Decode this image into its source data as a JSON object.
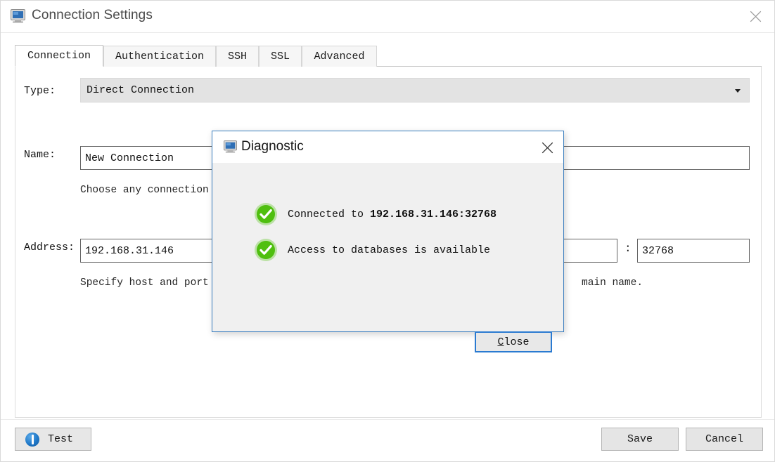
{
  "window": {
    "title": "Connection Settings",
    "icon": "monitor-icon",
    "close_icon": "close-icon"
  },
  "tabs": [
    {
      "label": "Connection",
      "active": true
    },
    {
      "label": "Authentication",
      "active": false
    },
    {
      "label": "SSH",
      "active": false
    },
    {
      "label": "SSL",
      "active": false
    },
    {
      "label": "Advanced",
      "active": false
    }
  ],
  "form": {
    "type_label": "Type:",
    "type_value": "Direct Connection",
    "name_label": "Name:",
    "name_value": "New Connection",
    "name_hint": "Choose any connection",
    "address_label": "Address:",
    "address_value": "192.168.31.146",
    "port_separator": ":",
    "port_value": "32768",
    "address_hint_left": "Specify host and port",
    "address_hint_right": "main name."
  },
  "bottom_bar": {
    "test_label": "Test",
    "test_icon": "info-icon",
    "save_label": "Save",
    "cancel_label": "Cancel"
  },
  "dialog": {
    "title": "Diagnostic",
    "icon": "monitor-icon",
    "close_icon": "close-icon",
    "rows": [
      {
        "icon": "check-circle-icon",
        "prefix": "Connected to ",
        "strong": "192.168.31.146:32768"
      },
      {
        "icon": "check-circle-icon",
        "prefix": "Access to databases is available",
        "strong": ""
      }
    ],
    "close_button": {
      "mnemonic": "C",
      "rest": "lose"
    }
  },
  "colors": {
    "dialog_border": "#3a7ebf",
    "focus_border": "#2a7ad1",
    "success_green": "#4fc114",
    "info_blue": "#1f78c8",
    "panel_bg": "#ffffff",
    "dialog_bg": "#f0f0f0"
  }
}
